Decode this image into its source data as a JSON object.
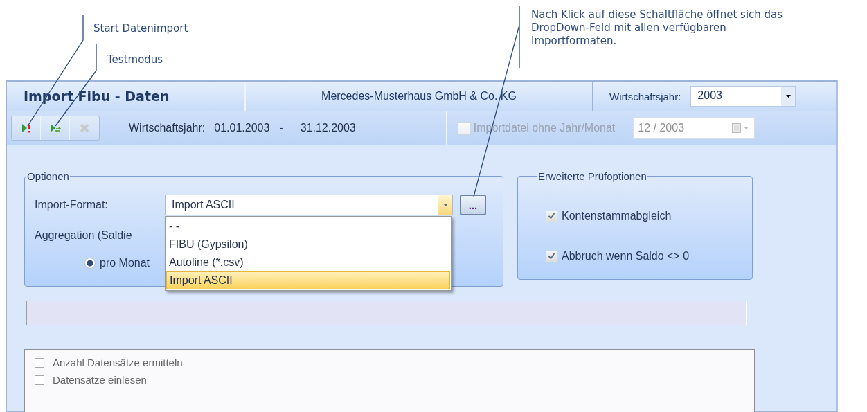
{
  "annotations": [
    {
      "text": "Start Datenimport"
    },
    {
      "text": "Testmodus"
    },
    {
      "text": "Nach Klick auf diese Schaltfläche öffnet sich das DropDown-Feld mit allen verfügbaren Importformaten."
    }
  ],
  "window": {
    "title": "Import Fibu - Daten",
    "company": "Mercedes-Musterhaus GmbH & Co. KG",
    "year_label": "Wirtschaftsjahr:",
    "year_value": "2003"
  },
  "toolbar": {
    "buttons": [
      {
        "kind": "start",
        "disabled": false
      },
      {
        "kind": "test",
        "disabled": false
      },
      {
        "kind": "cancel",
        "disabled": true
      }
    ],
    "period_label": "Wirtschaftsjahr:",
    "period_from": "01.01.2003",
    "period_separator": "-",
    "period_to": "31.12.2003",
    "no_period_checkbox": {
      "label": "Importdatei ohne Jahr/Monat",
      "checked": false,
      "disabled": true
    },
    "period_field": {
      "value": "12 / 2003",
      "disabled": true
    }
  },
  "options": {
    "title": "Optionen",
    "format_label": "Import-Format:",
    "format_value": "Import ASCII",
    "browse_button": "...",
    "format_options": [
      {
        "label": "- -",
        "selected": false
      },
      {
        "label": "FIBU (Gypsilon)",
        "selected": false
      },
      {
        "label": "Autoline (*.csv)",
        "selected": false
      },
      {
        "label": "Import ASCII",
        "selected": true
      }
    ],
    "aggregation_label": "Aggregation (Saldie",
    "radio": {
      "label": "pro Monat",
      "selected": true
    }
  },
  "checks": {
    "title": "Erweiterte Prüfoptionen",
    "items": [
      {
        "label": "Kontenstammabgleich",
        "checked": true
      },
      {
        "label": "Abbruch wenn Saldo <> 0",
        "checked": true
      }
    ]
  },
  "progress": {
    "level": 0
  },
  "steps": [
    {
      "label": "Anzahl Datensätze ermitteln",
      "checked": false
    },
    {
      "label": "Datensätze einlesen",
      "checked": false
    }
  ]
}
